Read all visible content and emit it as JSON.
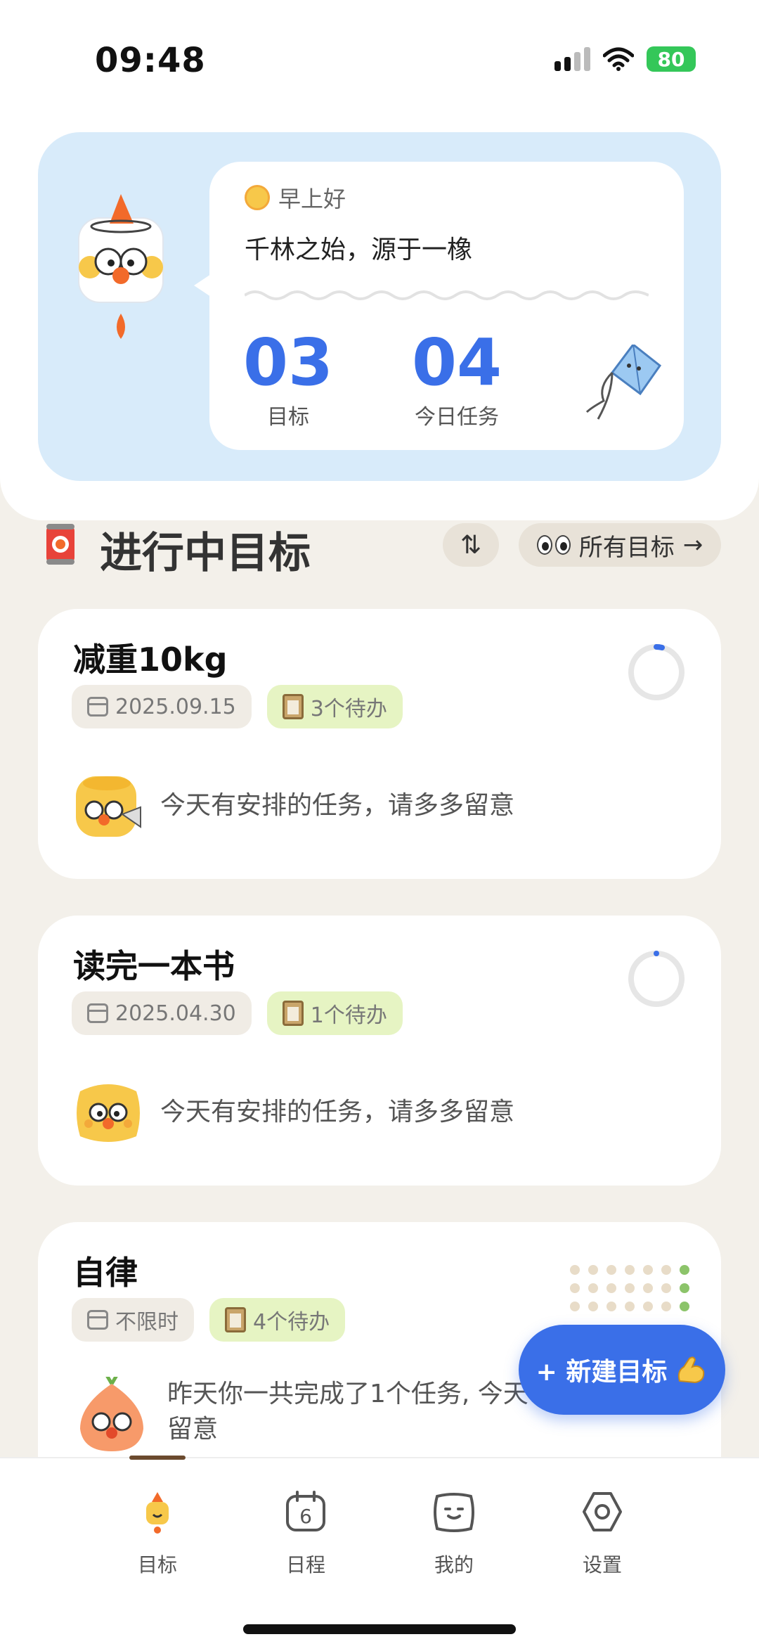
{
  "status_bar": {
    "time": "09:48",
    "battery": "80"
  },
  "banner": {
    "greeting": "早上好",
    "motto": "千林之始，源于一橡",
    "stats": [
      {
        "value": "03",
        "label": "目标"
      },
      {
        "value": "04",
        "label": "今日任务"
      }
    ]
  },
  "section": {
    "title": "进行中目标",
    "sort_label": "⇅",
    "all_goals_label": "所有目标",
    "all_goals_arrow": "→"
  },
  "goals": [
    {
      "title": "减重10kg",
      "date": "2025.09.15",
      "todo": "3个待办",
      "message": "今天有安排的任务，请多多留意",
      "progress": 0.03
    },
    {
      "title": "读完一本书",
      "date": "2025.04.30",
      "todo": "1个待办",
      "message": "今天有安排的任务，请多多留意",
      "progress": 0.01
    },
    {
      "title": "自律",
      "date": "不限时",
      "todo": "4个待办",
      "message": "昨天你一共完成了1个任务, 今天",
      "message_line2": "留意"
    }
  ],
  "fab": {
    "label": "+ 新建目标"
  },
  "tabbar": {
    "tabs": [
      {
        "label": "目标",
        "icon": "rocket-mascot-icon"
      },
      {
        "label": "日程",
        "icon": "calendar-6-icon"
      },
      {
        "label": "我的",
        "icon": "face-icon"
      },
      {
        "label": "设置",
        "icon": "hexagon-settings-icon"
      }
    ],
    "calendar_day": "6"
  },
  "colors": {
    "accent": "#3a6fe8",
    "banner": "#d8ebfa",
    "todo_tag": "#e6f4c3",
    "background": "#f3f0ea"
  }
}
